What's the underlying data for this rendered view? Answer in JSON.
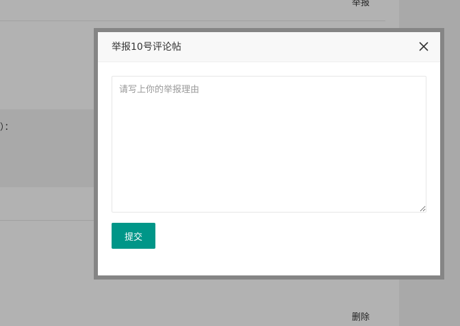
{
  "background": {
    "report_link": "举报",
    "delete_link": "删除",
    "quote_fragment": "）："
  },
  "dialog": {
    "title": "举报10号评论帖",
    "close_icon": "close-icon",
    "reason_placeholder": "请写上你的举报理由",
    "reason_value": "",
    "submit_label": "提交"
  },
  "colors": {
    "submit_button": "#009688",
    "overlay": "rgba(0,0,0,0.3)",
    "dialog_border": "#858585"
  }
}
